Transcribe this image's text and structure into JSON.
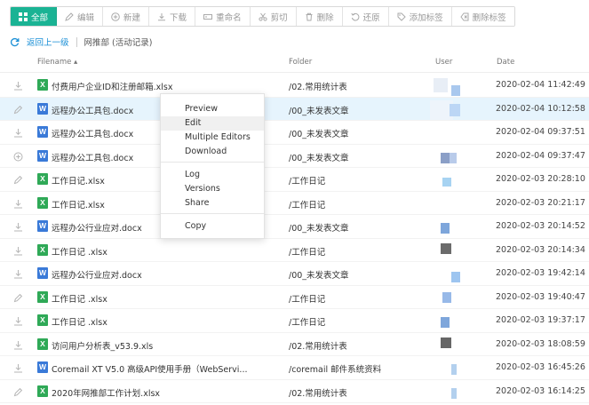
{
  "toolbar": {
    "buttons": [
      {
        "label": "全部",
        "icon": "grid-icon"
      },
      {
        "label": "编辑",
        "icon": "pencil-icon"
      },
      {
        "label": "新建",
        "icon": "plus-circle-icon"
      },
      {
        "label": "下载",
        "icon": "download-icon"
      },
      {
        "label": "重命名",
        "icon": "rename-icon"
      },
      {
        "label": "剪切",
        "icon": "scissors-icon"
      },
      {
        "label": "删除",
        "icon": "trash-icon"
      },
      {
        "label": "还原",
        "icon": "restore-icon"
      },
      {
        "label": "添加标签",
        "icon": "tag-add-icon"
      },
      {
        "label": "删除标签",
        "icon": "tag-remove-icon"
      }
    ]
  },
  "breadcrumb": {
    "back_label": "返回上一级",
    "path_label": "网推部 (活动记录)"
  },
  "table": {
    "headers": {
      "filename": "Filename ▴",
      "folder": "Folder",
      "user": "User",
      "date": "Date"
    },
    "rows": [
      {
        "action": "download-icon",
        "type": "xls",
        "name": "付费用户企业ID和注册邮箱.xlsx",
        "folder": "/02.常用统计表",
        "date": "2020-02-04 11:42:49"
      },
      {
        "action": "pencil-icon",
        "type": "doc",
        "name": "远程办公工具包.docx",
        "folder": "/00_未发表文章",
        "date": "2020-02-04 10:12:58"
      },
      {
        "action": "download-icon",
        "type": "doc",
        "name": "远程办公工具包.docx",
        "folder": "/00_未发表文章",
        "date": "2020-02-04 09:37:51"
      },
      {
        "action": "plus-circle-icon",
        "type": "doc",
        "name": "远程办公工具包.docx",
        "folder": "/00_未发表文章",
        "date": "2020-02-04 09:37:47"
      },
      {
        "action": "pencil-icon",
        "type": "xls",
        "name": "工作日记.xlsx",
        "folder": "/工作日记",
        "date": "2020-02-03 20:28:10"
      },
      {
        "action": "download-icon",
        "type": "xls",
        "name": "工作日记.xlsx",
        "folder": "/工作日记",
        "date": "2020-02-03 20:21:17"
      },
      {
        "action": "download-icon",
        "type": "doc",
        "name": "远程办公行业应对.docx",
        "folder": "/00_未发表文章",
        "date": "2020-02-03 20:14:52"
      },
      {
        "action": "download-icon",
        "type": "xls",
        "name": "工作日记 .xlsx",
        "folder": "/工作日记",
        "date": "2020-02-03 20:14:34"
      },
      {
        "action": "download-icon",
        "type": "doc",
        "name": "远程办公行业应对.docx",
        "folder": "/00_未发表文章",
        "date": "2020-02-03 19:42:14"
      },
      {
        "action": "pencil-icon",
        "type": "xls",
        "name": "工作日记 .xlsx",
        "folder": "/工作日记",
        "date": "2020-02-03 19:40:47"
      },
      {
        "action": "download-icon",
        "type": "xls",
        "name": "工作日记 .xlsx",
        "folder": "/工作日记",
        "date": "2020-02-03 19:37:17"
      },
      {
        "action": "download-icon",
        "type": "xls",
        "name": "访问用户分析表_v53.9.xls",
        "folder": "/02.常用统计表",
        "date": "2020-02-03 18:08:59"
      },
      {
        "action": "download-icon",
        "type": "doc",
        "name": "Coremail XT V5.0 高级API使用手册（WebServi...",
        "folder": "/coremail 邮件系统资料",
        "date": "2020-02-03 16:45:26"
      },
      {
        "action": "pencil-icon",
        "type": "xls",
        "name": "2020年网推部工作计划.xlsx",
        "folder": "/02.常用统计表",
        "date": "2020-02-03 16:14:25"
      }
    ]
  },
  "context_menu": {
    "items": [
      "Preview",
      "Edit",
      "Multiple Editors",
      "Download",
      "Log",
      "Versions",
      "Share",
      "Copy"
    ],
    "highlighted": "Edit"
  },
  "colors": {
    "accent": "#1ab394",
    "link": "#1a8fd6",
    "selected_row": "#e6f4fd",
    "xls_icon": "#2fa957",
    "doc_icon": "#3a7ad8"
  }
}
